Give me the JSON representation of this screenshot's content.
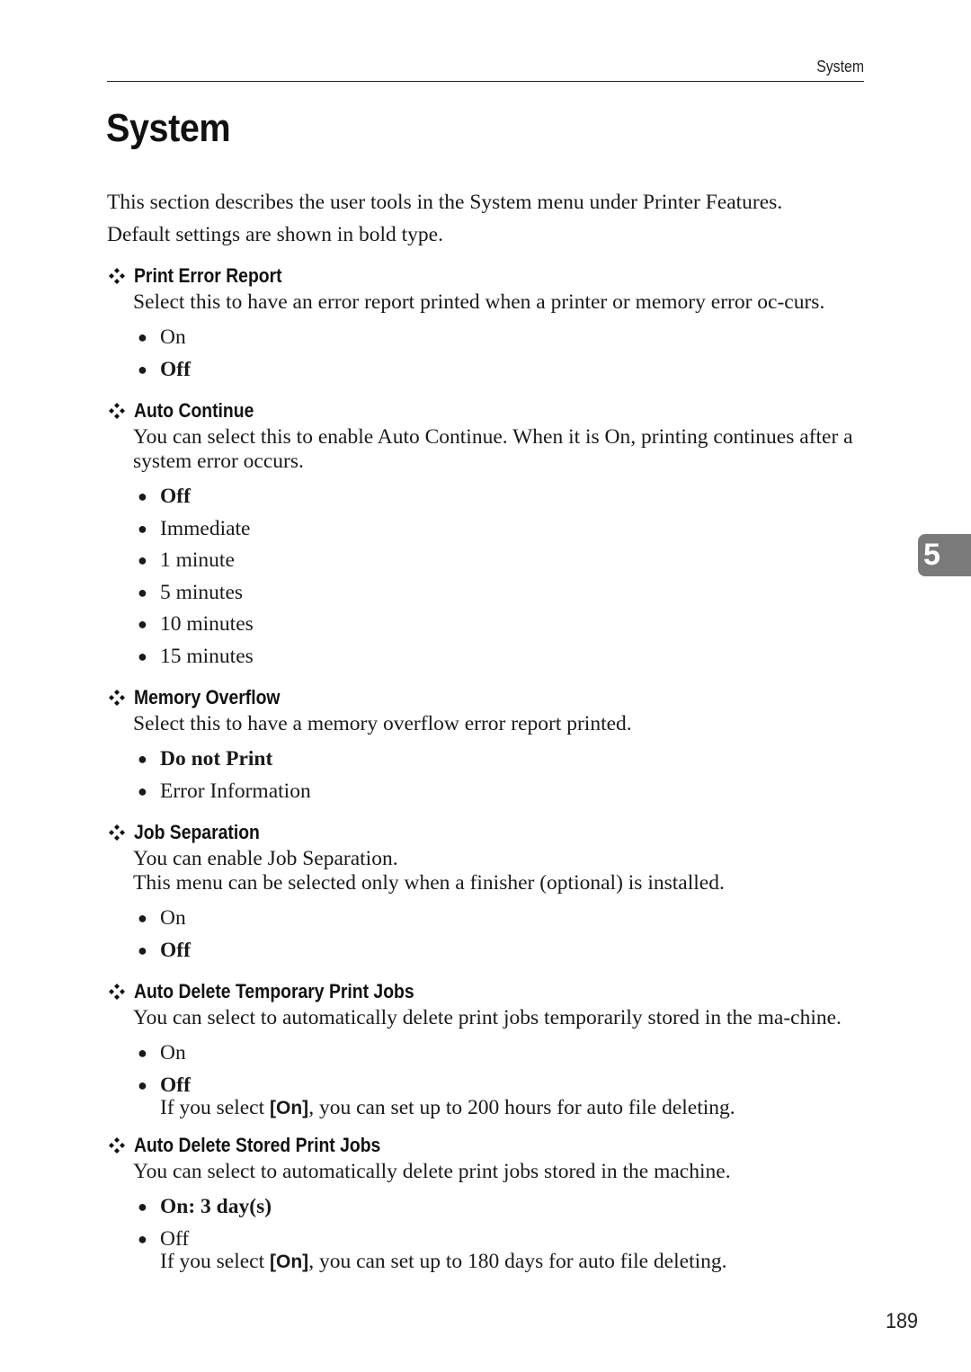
{
  "header": {
    "running_title": "System"
  },
  "page_title": "System",
  "intro": {
    "line1": "This section describes the user tools in the System menu under Printer Features.",
    "line2": "Default settings are shown in bold type."
  },
  "sections": [
    {
      "title": "Print Error Report",
      "description": [
        "Select this to have an error report printed when a printer or memory error oc-curs."
      ],
      "options": [
        {
          "label": "On",
          "default": false
        },
        {
          "label": "Off",
          "default": true
        }
      ]
    },
    {
      "title": "Auto Continue",
      "description": [
        "You can select this to enable Auto Continue. When it is On, printing continues after a system error occurs."
      ],
      "options": [
        {
          "label": "Off",
          "default": true
        },
        {
          "label": "Immediate",
          "default": false
        },
        {
          "label": "1 minute",
          "default": false
        },
        {
          "label": "5 minutes",
          "default": false
        },
        {
          "label": "10 minutes",
          "default": false
        },
        {
          "label": "15 minutes",
          "default": false
        }
      ]
    },
    {
      "title": "Memory Overflow",
      "description": [
        "Select this to have a memory overflow error report printed."
      ],
      "options": [
        {
          "label": "Do not Print",
          "default": true
        },
        {
          "label": "Error Information",
          "default": false
        }
      ]
    },
    {
      "title": "Job Separation",
      "description": [
        "You can enable Job Separation.",
        "This menu can be selected only when a finisher (optional) is installed."
      ],
      "options": [
        {
          "label": "On",
          "default": false
        },
        {
          "label": "Off",
          "default": true
        }
      ]
    },
    {
      "title": "Auto Delete Temporary Print Jobs",
      "description": [
        "You can select to automatically delete print jobs temporarily stored in the ma-chine."
      ],
      "options": [
        {
          "label": "On",
          "default": false
        },
        {
          "label": "Off",
          "default": true
        }
      ],
      "note": {
        "before": "If you select ",
        "key": "[On]",
        "after": ", you can set up to 200 hours for auto file deleting."
      }
    },
    {
      "title": "Auto Delete Stored Print Jobs",
      "description": [
        "You can select to automatically delete print jobs stored in the machine."
      ],
      "options": [
        {
          "label": "On: 3 day(s)",
          "default": true
        },
        {
          "label": "Off",
          "default": false
        }
      ],
      "note": {
        "before": "If you select ",
        "key": "[On]",
        "after": ", you can set up to 180 days for auto file deleting."
      }
    }
  ],
  "chapter_tab": "5",
  "page_number": "189",
  "colors": {
    "chapter_tab_bg": "#7a7a7a",
    "text": "#1a1a1a"
  }
}
